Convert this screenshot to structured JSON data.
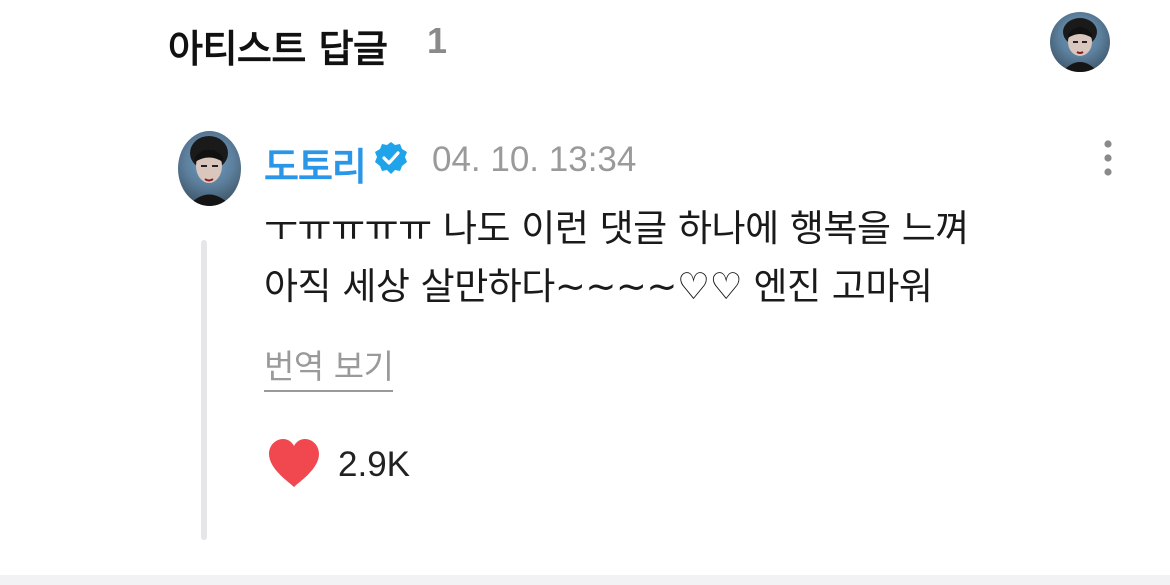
{
  "header": {
    "title": "아티스트 답글",
    "count": "1"
  },
  "comment": {
    "author": "도토리",
    "timestamp": "04. 10. 13:34",
    "body": "ㅜㅠㅠㅠㅠ 나도 이런 댓글 하나에 행복을 느껴\n아직 세상 살만하다~~~~♡♡ 엔진 고마워",
    "translate_label": "번역 보기",
    "like_count": "2.9K",
    "verified_icon": "verified-badge-icon",
    "more_icon": "more-vertical-icon",
    "like_icon": "heart-icon"
  },
  "colors": {
    "author": "#2a96e8",
    "heart": "#f0484e",
    "verified": "#1fa3ea",
    "muted": "#9a9a9a"
  }
}
